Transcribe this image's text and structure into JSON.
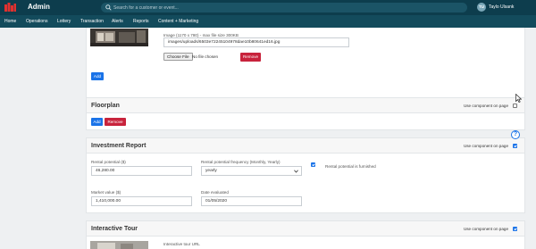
{
  "header": {
    "app_title": "Admin",
    "search_placeholder": "Search for a customer or event...",
    "user_initials": "TU",
    "user_name": "Taylo Ulsank"
  },
  "nav": [
    {
      "label": "Home"
    },
    {
      "label": "Operations"
    },
    {
      "label": "Lottery"
    },
    {
      "label": "Transaction"
    },
    {
      "label": "Alerts"
    },
    {
      "label": "Reports"
    },
    {
      "label": "Content + Marketing"
    }
  ],
  "image_section": {
    "hint": "Image (1170 x 780) - max file size 300KB",
    "path_value": "images/uploads/6503e72245104978dae10b80641ed16.jpg",
    "choose_file_label": "Choose File",
    "no_file_text": "No file chosen",
    "remove_label": "Remove",
    "add_label": "Add"
  },
  "floorplan": {
    "title": "Floorplan",
    "use_component_label": "Use component on page",
    "use_component_checked": false,
    "add_label": "Add",
    "remove_label": "Remove"
  },
  "investment_report": {
    "title": "Investment Report",
    "use_component_label": "Use component on page",
    "use_component_checked": true,
    "rental_potential_label": "Rental potential ($)",
    "rental_potential_value": "46,280.00",
    "frequency_label": "Rental potential frequency (Monthly, Yearly)",
    "frequency_value": "yearly",
    "furnished_label": "Rental potential is furnished",
    "furnished_checked": true,
    "market_value_label": "Market value ($)",
    "market_value_value": "1,410,000.00",
    "date_evaluated_label": "Date evaluated",
    "date_evaluated_value": "01/05/2020",
    "help_label": "?"
  },
  "interactive_tour": {
    "title": "Interactive Tour",
    "use_component_label": "Use component on page",
    "use_component_checked": true,
    "url_label": "Interactive tour URL"
  },
  "colors": {
    "topbar": "#0d3d4d",
    "navbar": "#134b5c",
    "primary": "#1a73e8",
    "danger": "#c8233c"
  },
  "icons": [
    "logo-icon",
    "search-icon",
    "chevron-down-icon",
    "help-icon",
    "mouse-cursor-icon"
  ]
}
